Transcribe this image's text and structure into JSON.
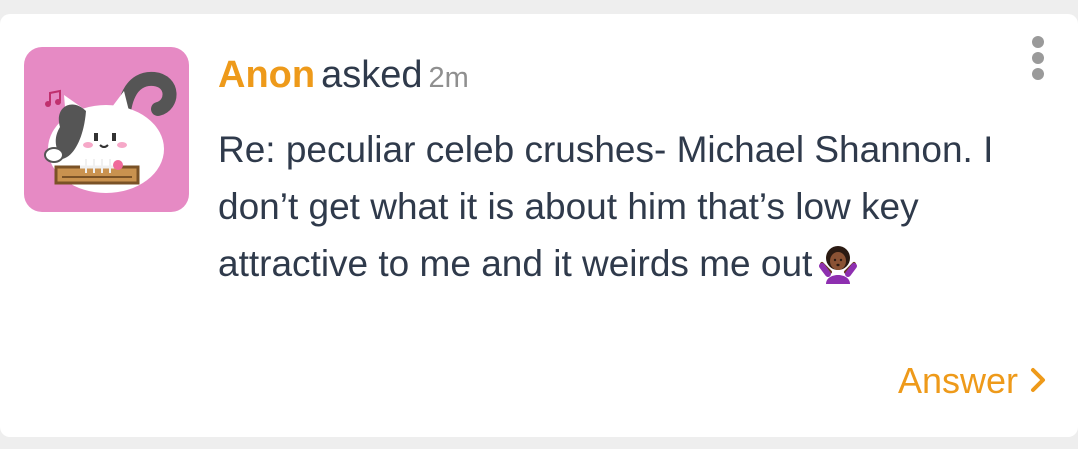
{
  "post": {
    "author": "Anon",
    "verb": "asked",
    "time": "2m",
    "question": "Re: peculiar celeb crushes- Michael Shannon. I don’t get what it is about him that’s low key attractive to me and it weirds me out",
    "emoji": "person-shrugging-icon"
  },
  "actions": {
    "answer_label": "Answer"
  },
  "avatar": {
    "icon": "cat-avatar-icon",
    "background": "#e68ac4"
  },
  "colors": {
    "accent": "#ee9a1a",
    "text": "#2f3a4b",
    "muted": "#8f8f8f"
  }
}
